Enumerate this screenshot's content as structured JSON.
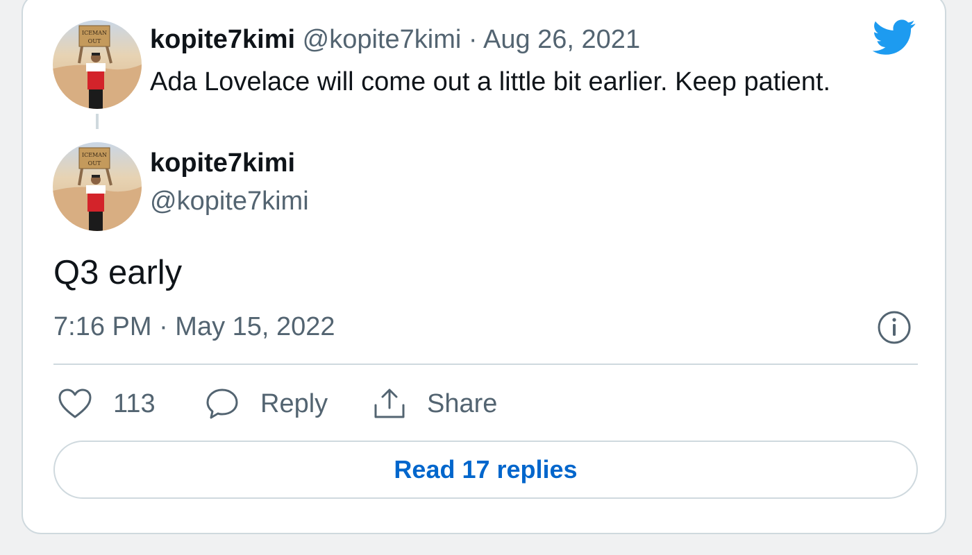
{
  "parent_tweet": {
    "author_name": "kopite7kimi",
    "author_handle": "@kopite7kimi",
    "separator": "·",
    "date": "Aug 26, 2021",
    "text": "Ada Lovelace will come out a little bit earlier. Keep patient.",
    "avatar_sign_line1": "ICEMAN",
    "avatar_sign_line2": "OUT"
  },
  "main_tweet": {
    "author_name": "kopite7kimi",
    "author_handle": "@kopite7kimi",
    "text": "Q3 early",
    "timestamp": "7:16 PM · May 15, 2022",
    "avatar_sign_line1": "ICEMAN",
    "avatar_sign_line2": "OUT"
  },
  "actions": {
    "like_count": "113",
    "reply_label": "Reply",
    "share_label": "Share"
  },
  "read_replies_label": "Read 17 replies",
  "colors": {
    "accent_blue": "#1d9bf0",
    "link_blue": "#0066cc",
    "muted_text": "#536471",
    "border": "#cfd9de",
    "background": "#f0f1f2"
  }
}
